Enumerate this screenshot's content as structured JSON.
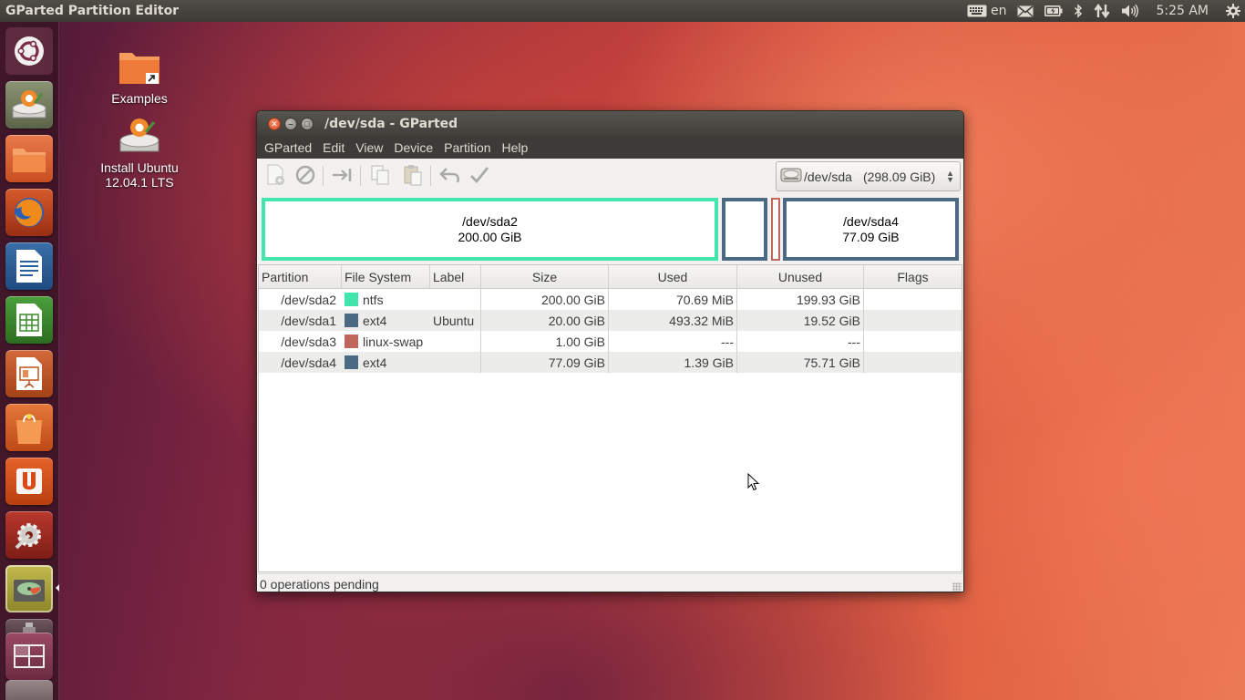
{
  "top_panel": {
    "app_title": "GParted Partition Editor",
    "keyboard_layout": "en",
    "clock": "5:25 AM",
    "icons": [
      "keyboard-icon",
      "mail-icon",
      "battery-icon",
      "bluetooth-icon",
      "network-icon",
      "volume-icon",
      "power-icon"
    ]
  },
  "launcher": {
    "items": [
      "dash-home",
      "install-ubuntu",
      "files",
      "firefox",
      "libreoffice-writer",
      "libreoffice-calc",
      "libreoffice-impress",
      "ubuntu-software-center",
      "ubuntu-one",
      "system-settings",
      "gparted",
      "usb-drive",
      "workspace-switcher"
    ]
  },
  "desktop": {
    "icons": [
      {
        "label": "Examples"
      },
      {
        "label": "Install Ubuntu 12.04.1 LTS"
      }
    ]
  },
  "window": {
    "title": "/dev/sda - GParted",
    "menu": [
      "GParted",
      "Edit",
      "View",
      "Device",
      "Partition",
      "Help"
    ],
    "device_selector": {
      "device": "/dev/sda",
      "size": "(298.09 GiB)"
    },
    "partition_map": [
      {
        "name": "/dev/sda2",
        "size": "200.00 GiB",
        "color": "#42e5ac"
      },
      {
        "name": "",
        "size": "",
        "color": "#4b6983"
      },
      {
        "name": "",
        "size": "",
        "color": "#c1665a"
      },
      {
        "name": "/dev/sda4",
        "size": "77.09 GiB",
        "color": "#4b6983"
      }
    ],
    "columns": [
      "Partition",
      "File System",
      "Label",
      "Size",
      "Used",
      "Unused",
      "Flags"
    ],
    "rows": [
      {
        "partition": "/dev/sda2",
        "fs": "ntfs",
        "fs_color": "#42e5ac",
        "label": "",
        "size": "200.00 GiB",
        "used": "70.69 MiB",
        "unused": "199.93 GiB",
        "flags": ""
      },
      {
        "partition": "/dev/sda1",
        "fs": "ext4",
        "fs_color": "#4b6983",
        "label": "Ubuntu",
        "size": "20.00 GiB",
        "used": "493.32 MiB",
        "unused": "19.52 GiB",
        "flags": ""
      },
      {
        "partition": "/dev/sda3",
        "fs": "linux-swap",
        "fs_color": "#c1665a",
        "label": "",
        "size": "1.00 GiB",
        "used": "---",
        "unused": "---",
        "flags": ""
      },
      {
        "partition": "/dev/sda4",
        "fs": "ext4",
        "fs_color": "#4b6983",
        "label": "",
        "size": "77.09 GiB",
        "used": "1.39 GiB",
        "unused": "75.71 GiB",
        "flags": ""
      }
    ],
    "status": "0 operations pending"
  },
  "colors": {
    "ntfs": "#42e5ac",
    "ext4": "#4b6983",
    "linux_swap": "#c1665a",
    "panel": "#3c3b37",
    "close_button": "#e0502b"
  }
}
